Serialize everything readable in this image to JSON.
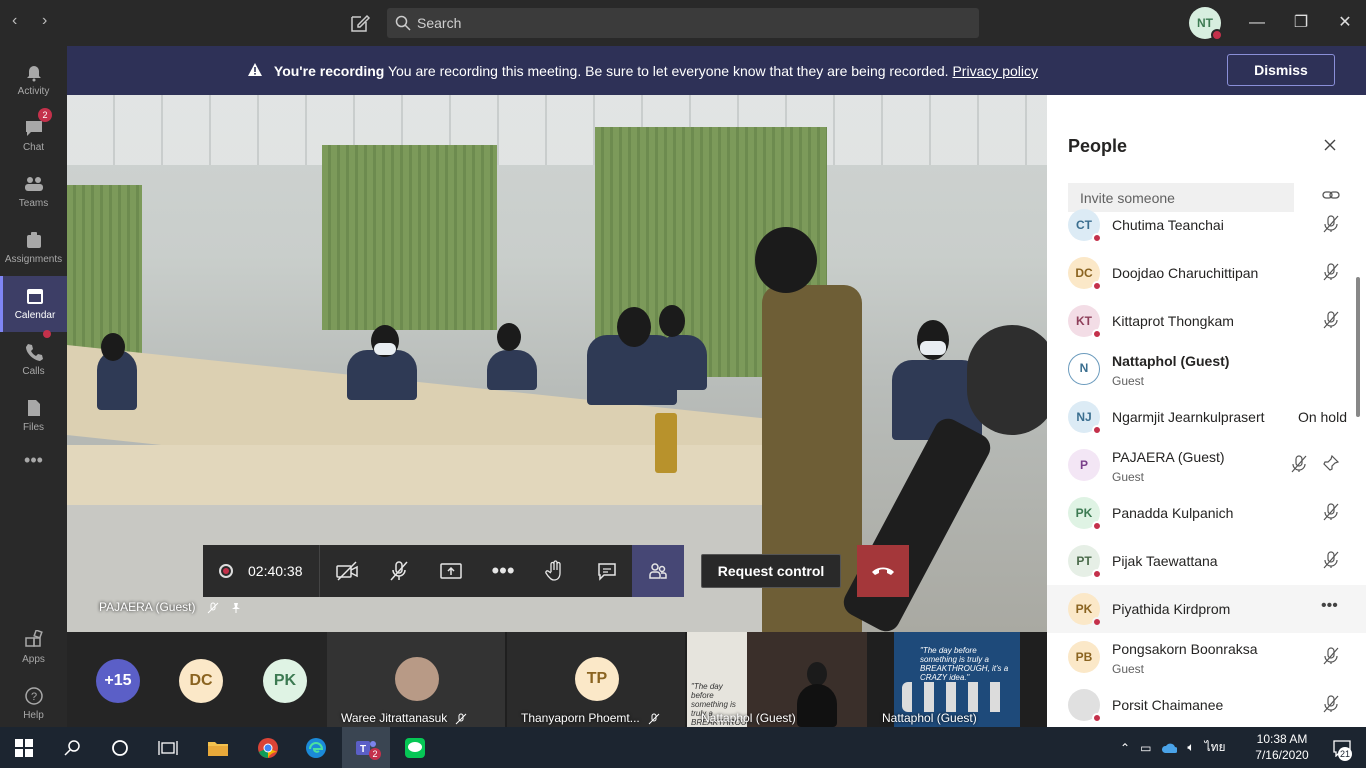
{
  "window": {
    "search_placeholder": "Search",
    "user_initials": "NT"
  },
  "rail": {
    "items": [
      {
        "label": "Activity"
      },
      {
        "label": "Chat",
        "badge": "2"
      },
      {
        "label": "Teams"
      },
      {
        "label": "Assignments"
      },
      {
        "label": "Calendar",
        "active": true
      },
      {
        "label": "Calls"
      },
      {
        "label": "Files"
      },
      {
        "label": "Apps"
      },
      {
        "label": "Help"
      }
    ]
  },
  "banner": {
    "title": "You're recording",
    "message": "You are recording this meeting. Be sure to let everyone know that they are being recorded.",
    "link": "Privacy policy",
    "dismiss": "Dismiss"
  },
  "stage": {
    "pinned_name": "PAJAERA (Guest)"
  },
  "controls": {
    "timer": "02:40:38",
    "request_control": "Request control"
  },
  "strip": {
    "overflow": "+15",
    "tiles": [
      {
        "initials": "DC"
      },
      {
        "initials": "PK"
      },
      {
        "name": "Waree Jitrattanasuk"
      },
      {
        "initials": "TP",
        "name": "Thanyaporn Phoemt..."
      },
      {
        "name": "Nattaphol (Guest)",
        "slide": "\"The day before something is truly a BREAKTHROUGH, it's a CRAZY idea.\""
      },
      {
        "name": "Nattaphol (Guest)",
        "slide": "\"The day before something is truly a BREAKTHROUGH, it's a CRAZY idea.\""
      }
    ]
  },
  "people": {
    "title": "People",
    "invite_placeholder": "Invite someone",
    "list": [
      {
        "initials": "CT",
        "name": "Chutima Teanchai",
        "sub": "",
        "right": "",
        "color": "#dcebf5",
        "fg": "#3a6e8f"
      },
      {
        "initials": "DC",
        "name": "Doojdao Charuchittipan",
        "sub": "",
        "right": "",
        "color": "#fbe8c8",
        "fg": "#8a6320"
      },
      {
        "initials": "KT",
        "name": "Kittaprot Thongkam",
        "sub": "",
        "right": "",
        "color": "#f3dde6",
        "fg": "#8e3f5a"
      },
      {
        "initials": "N",
        "name": "Nattaphol (Guest)",
        "sub": "Guest",
        "right": "",
        "color": "#ffffff",
        "fg": "#3a6e8f"
      },
      {
        "initials": "NJ",
        "name": "Ngarmjit Jearnkulprasert",
        "sub": "",
        "right": "On hold",
        "color": "#dcebf5",
        "fg": "#3a6e8f"
      },
      {
        "initials": "P",
        "name": "PAJAERA (Guest)",
        "sub": "Guest",
        "right": "",
        "color": "#f3e6f5",
        "fg": "#7a3f8a"
      },
      {
        "initials": "PK",
        "name": "Panadda Kulpanich",
        "sub": "",
        "right": "",
        "color": "#dff3e4",
        "fg": "#3c7a52"
      },
      {
        "initials": "PT",
        "name": "Pijak Taewattana",
        "sub": "",
        "right": "",
        "color": "#e6efe6",
        "fg": "#4a6a4a"
      },
      {
        "initials": "PK",
        "name": "Piyathida Kirdprom",
        "sub": "",
        "right": "",
        "color": "#fbe8c8",
        "fg": "#8a6320"
      },
      {
        "initials": "PB",
        "name": "Pongsakorn Boonraksa",
        "sub": "Guest",
        "right": "",
        "color": "#fbe8c8",
        "fg": "#8a6320"
      },
      {
        "initials": "",
        "name": "Porsit Chaimanee",
        "sub": "",
        "right": "",
        "color": "#e0e0e0",
        "fg": "#555"
      }
    ]
  },
  "taskbar": {
    "lang": "ไทย",
    "time": "10:38 AM",
    "date": "7/16/2020",
    "notif": "21",
    "teams_badge": "2"
  }
}
